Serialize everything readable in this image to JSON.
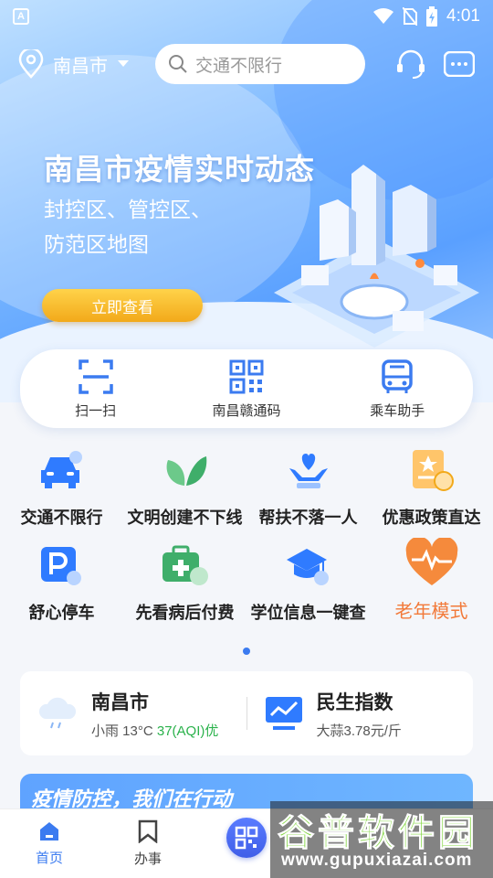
{
  "status_bar": {
    "time": "4:01",
    "sys_icon": "A"
  },
  "header": {
    "city": "南昌市",
    "search_placeholder": "交通不限行"
  },
  "banner": {
    "title": "南昌市疫情实时动态",
    "subtitle_line1": "封控区、管控区、",
    "subtitle_line2": "防范区地图",
    "button": "立即查看"
  },
  "quick_actions": [
    {
      "label": "扫一扫",
      "icon": "scan-icon"
    },
    {
      "label": "南昌赣通码",
      "icon": "qr-code-icon"
    },
    {
      "label": "乘车助手",
      "icon": "bus-icon"
    }
  ],
  "services_row1": [
    {
      "label": "交通不限行",
      "icon": "car-icon"
    },
    {
      "label": "文明创建不下线",
      "icon": "leaf-icon"
    },
    {
      "label": "帮扶不落一人",
      "icon": "helping-hands-icon"
    },
    {
      "label": "优惠政策直达",
      "icon": "document-star-icon"
    }
  ],
  "services_row2": [
    {
      "label": "舒心停车",
      "icon": "parking-icon"
    },
    {
      "label": "先看病后付费",
      "icon": "medical-kit-icon"
    },
    {
      "label": "学位信息一键查",
      "icon": "graduation-cap-icon"
    }
  ],
  "elder_mode": {
    "label": "老年模式",
    "icon": "heart-pulse-icon"
  },
  "weather": {
    "city": "南昌市",
    "desc": "小雨 13°C",
    "aqi": "37(AQI)优"
  },
  "index": {
    "title": "民生指数",
    "detail": "大蒜3.78元/斤"
  },
  "promo": {
    "title": "疫情防控，我们在行动"
  },
  "tabs": [
    {
      "label": "首页",
      "icon": "home-icon"
    },
    {
      "label": "办事",
      "icon": "bookmark-icon"
    }
  ],
  "watermark": {
    "brand": "谷普软件园",
    "url": "www.gupuxiazai.com"
  },
  "colors": {
    "primary": "#3b7bf0",
    "accent_orange": "#f27a3a",
    "aqi_green": "#2bb24c",
    "button_gold": "#f2a91a"
  }
}
